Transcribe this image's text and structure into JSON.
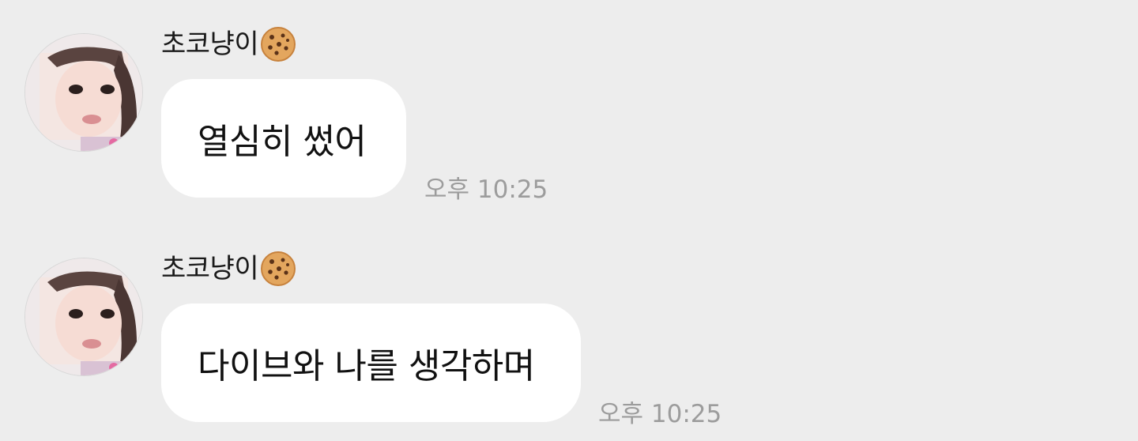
{
  "messages": [
    {
      "sender": "초코냥이",
      "sender_emoji": "cookie-icon",
      "text": "열심히 썼어",
      "time": "오후 10:25"
    },
    {
      "sender": "초코냥이",
      "sender_emoji": "cookie-icon",
      "text": "다이브와 나를 생각하며",
      "time": "오후 10:25"
    }
  ],
  "colors": {
    "background": "#ededed",
    "bubble": "#ffffff",
    "timestamp": "#9c9c9c"
  }
}
